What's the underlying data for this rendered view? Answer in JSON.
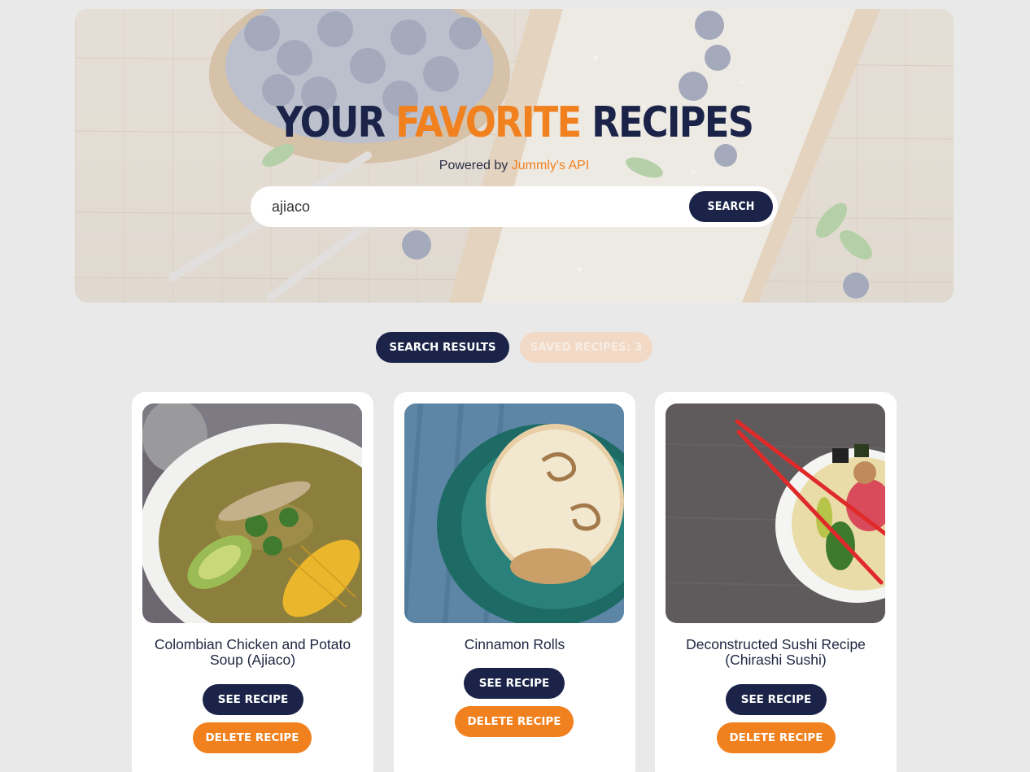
{
  "hero": {
    "title_part1": "YOUR",
    "title_accent": "FAVORITE",
    "title_part3": "RECIPES",
    "powered_by": "Powered by",
    "api_link": "Jummly's API"
  },
  "search": {
    "value": "ajiaco",
    "button_label": "SEARCH"
  },
  "tabs": {
    "results_label": "SEARCH RESULTS",
    "saved_label": "SAVED RECIPES: 3"
  },
  "recipes": [
    {
      "title": "Colombian Chicken and Potato Soup (Ajiaco)",
      "see_label": "SEE RECIPE",
      "delete_label": "DELETE RECIPE",
      "image_icon": "ajiaco-soup-photo"
    },
    {
      "title": "Cinnamon Rolls",
      "see_label": "SEE RECIPE",
      "delete_label": "DELETE RECIPE",
      "image_icon": "cinnamon-rolls-photo"
    },
    {
      "title": "Deconstructed Sushi Recipe (Chirashi Sushi)",
      "see_label": "SEE RECIPE",
      "delete_label": "DELETE RECIPE",
      "image_icon": "chirashi-sushi-photo"
    }
  ],
  "colors": {
    "navy": "#1b2448",
    "orange": "#f1801e",
    "page_background": "#e9e9e9",
    "saved_tab_background": "#f2d9c6"
  }
}
